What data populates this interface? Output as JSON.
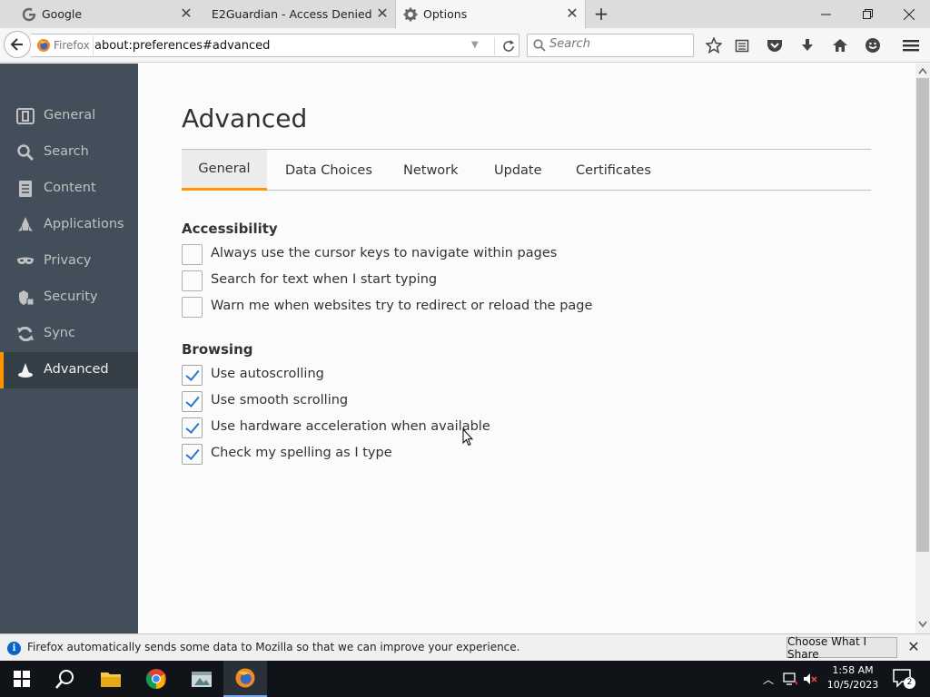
{
  "browser": {
    "tabs": [
      {
        "title": "Google",
        "icon": "google-icon",
        "active": false
      },
      {
        "title": "E2Guardian - Access Denied",
        "icon": "document-icon",
        "active": false
      },
      {
        "title": "Options",
        "icon": "gear-icon",
        "active": true
      }
    ],
    "identity_label": "Firefox",
    "url": "about:preferences#advanced",
    "search_placeholder": "Search",
    "brand_color": "#ff9500"
  },
  "sidebar": {
    "items": [
      {
        "label": "General",
        "icon": "general-icon"
      },
      {
        "label": "Search",
        "icon": "search-icon"
      },
      {
        "label": "Content",
        "icon": "content-icon"
      },
      {
        "label": "Applications",
        "icon": "applications-icon"
      },
      {
        "label": "Privacy",
        "icon": "privacy-mask-icon"
      },
      {
        "label": "Security",
        "icon": "security-icon"
      },
      {
        "label": "Sync",
        "icon": "sync-icon"
      },
      {
        "label": "Advanced",
        "icon": "advanced-wizard-icon",
        "selected": true
      }
    ]
  },
  "page": {
    "title": "Advanced",
    "tabs": [
      {
        "label": "General",
        "selected": true
      },
      {
        "label": "Data Choices"
      },
      {
        "label": "Network"
      },
      {
        "label": "Update"
      },
      {
        "label": "Certificates"
      }
    ],
    "accessibility": {
      "heading": "Accessibility",
      "options": [
        {
          "label": "Always use the cursor keys to navigate within pages",
          "checked": false
        },
        {
          "label": "Search for text when I start typing",
          "checked": false
        },
        {
          "label": "Warn me when websites try to redirect or reload the page",
          "checked": false
        }
      ]
    },
    "browsing": {
      "heading": "Browsing",
      "options": [
        {
          "label": "Use autoscrolling",
          "checked": true
        },
        {
          "label": "Use smooth scrolling",
          "checked": true
        },
        {
          "label": "Use hardware acceleration when available",
          "checked": true
        },
        {
          "label": "Check my spelling as I type",
          "checked": true
        }
      ]
    }
  },
  "notification": {
    "message": "Firefox automatically sends some data to Mozilla so that we can improve your experience.",
    "button": "Choose What I Share"
  },
  "taskbar": {
    "time": "1:58 AM",
    "date": "10/5/2023",
    "notification_count": "2"
  }
}
